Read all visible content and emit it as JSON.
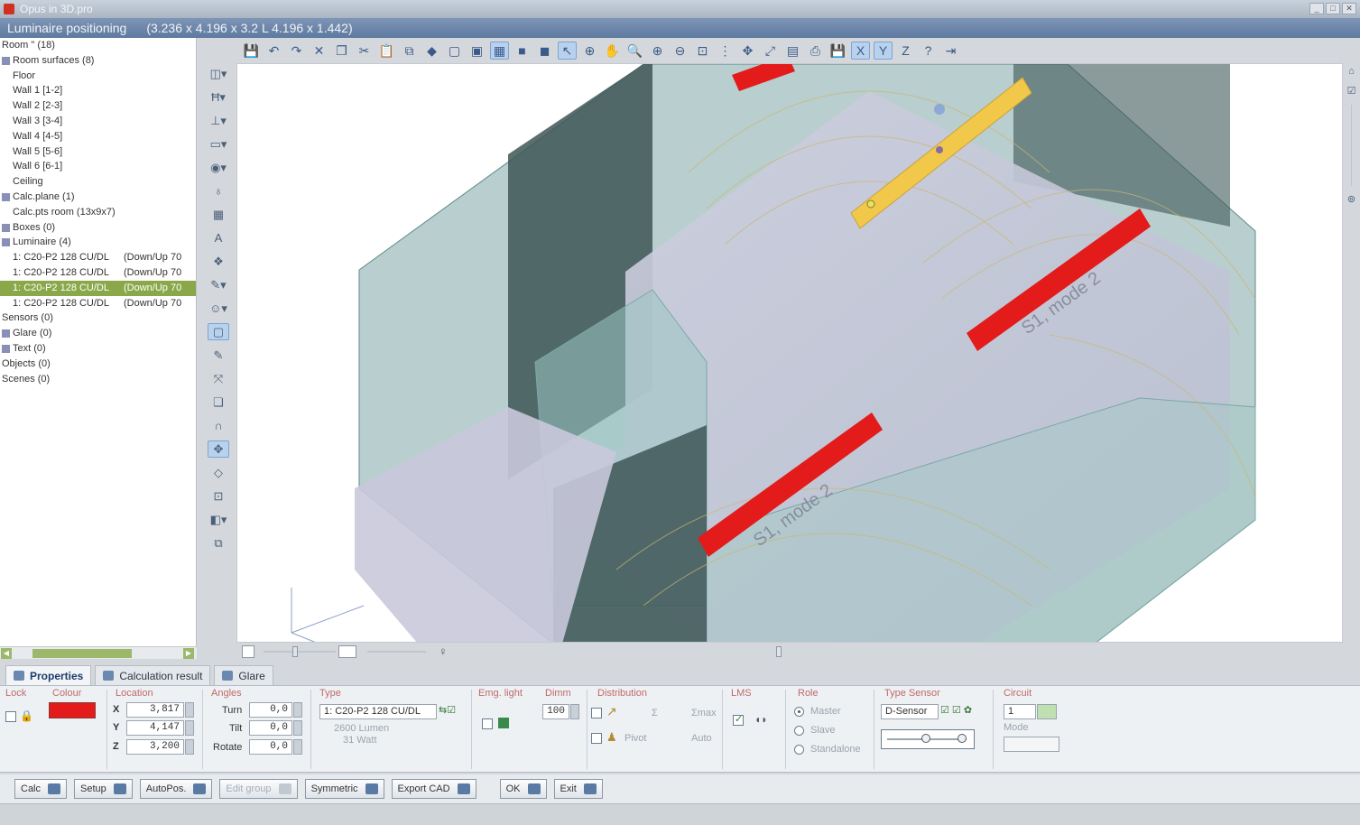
{
  "window": {
    "app_title": "Opus in 3D.pro",
    "subtitle": "Luminaire positioning",
    "dimensions": "(3.236 x 4.196 x 3.2 L 4.196 x 1.442)"
  },
  "tree": [
    {
      "label": "Room \" (18)",
      "indent": 0,
      "icon": false
    },
    {
      "label": "Room surfaces (8)",
      "indent": 0,
      "icon": true
    },
    {
      "label": "Floor",
      "indent": 12
    },
    {
      "label": "Wall 1 [1-2]",
      "indent": 12
    },
    {
      "label": "Wall 2 [2-3]",
      "indent": 12
    },
    {
      "label": "Wall 3 [3-4]",
      "indent": 12
    },
    {
      "label": "Wall 4 [4-5]",
      "indent": 12
    },
    {
      "label": "Wall 5 [5-6]",
      "indent": 12
    },
    {
      "label": "Wall 6 [6-1]",
      "indent": 12
    },
    {
      "label": "Ceiling",
      "indent": 12
    },
    {
      "label": "Calc.plane (1)",
      "indent": 0,
      "icon": true
    },
    {
      "label": "Calc.pts room (13x9x7)",
      "indent": 12
    },
    {
      "label": "Boxes (0)",
      "indent": 0,
      "icon": true
    },
    {
      "label": "Luminaire (4)",
      "indent": 0,
      "icon": true
    },
    {
      "label": "1: C20-P2 128 CU/DL",
      "col2": "(Down/Up 70",
      "indent": 12
    },
    {
      "label": "1: C20-P2 128 CU/DL",
      "col2": "(Down/Up 70",
      "indent": 12
    },
    {
      "label": "1: C20-P2 128 CU/DL",
      "col2": "(Down/Up 70",
      "indent": 12,
      "selected": true
    },
    {
      "label": "1: C20-P2 128 CU/DL",
      "col2": "(Down/Up 70",
      "indent": 12
    },
    {
      "label": "Sensors (0)",
      "indent": 0
    },
    {
      "label": "Glare (0)",
      "indent": 0,
      "icon": true
    },
    {
      "label": "Text (0)",
      "indent": 0,
      "icon": true
    },
    {
      "label": "Objects (0)",
      "indent": 0
    },
    {
      "label": "Scenes (0)",
      "indent": 0
    }
  ],
  "toolbar_top": [
    {
      "icon": "save-icon",
      "glyph": "💾"
    },
    {
      "icon": "undo-icon",
      "glyph": "↶"
    },
    {
      "icon": "redo-icon",
      "glyph": "↷"
    },
    {
      "icon": "delete-icon",
      "glyph": "✕"
    },
    {
      "icon": "copy-icon",
      "glyph": "❐"
    },
    {
      "icon": "cut-icon",
      "glyph": "✂"
    },
    {
      "icon": "paste-icon",
      "glyph": "📋"
    },
    {
      "icon": "duplicate-icon",
      "glyph": "⧉"
    },
    {
      "icon": "render-icon",
      "glyph": "◆"
    },
    {
      "icon": "view-front-icon",
      "glyph": "▢"
    },
    {
      "icon": "view-side-icon",
      "glyph": "▣"
    },
    {
      "icon": "view-top-icon",
      "glyph": "▦",
      "active": true
    },
    {
      "icon": "view-3d-icon",
      "glyph": "■"
    },
    {
      "icon": "view-iso-icon",
      "glyph": "◼"
    },
    {
      "icon": "select-icon",
      "glyph": "↖",
      "active": true
    },
    {
      "icon": "rotate-view-icon",
      "glyph": "⊕"
    },
    {
      "icon": "pan-icon",
      "glyph": "✋"
    },
    {
      "icon": "zoom-icon",
      "glyph": "🔍"
    },
    {
      "icon": "zoom-in-icon",
      "glyph": "⊕"
    },
    {
      "icon": "zoom-out-icon",
      "glyph": "⊖"
    },
    {
      "icon": "zoom-fit-icon",
      "glyph": "⊡"
    },
    {
      "icon": "grid-icon",
      "glyph": "⋮"
    },
    {
      "icon": "move-icon",
      "glyph": "✥"
    },
    {
      "icon": "measure-icon",
      "glyph": "⤢"
    },
    {
      "icon": "display-mode-icon",
      "glyph": "▤"
    },
    {
      "icon": "print-icon",
      "glyph": "⎙"
    },
    {
      "icon": "export-icon",
      "glyph": "💾"
    },
    {
      "icon": "xyz-icon",
      "glyph": "X",
      "active": true
    },
    {
      "icon": "y-axis-icon",
      "glyph": "Y",
      "active": true
    },
    {
      "icon": "z-axis-icon",
      "glyph": "Z"
    },
    {
      "icon": "help-icon",
      "glyph": "?"
    },
    {
      "icon": "exit-icon",
      "glyph": "⇥"
    }
  ],
  "toolbar_left": [
    {
      "icon": "box-tool-icon",
      "glyph": "◫▾"
    },
    {
      "icon": "luminaire-tool-icon",
      "glyph": "Ħ▾"
    },
    {
      "icon": "array-tool-icon",
      "glyph": "⊥▾"
    },
    {
      "icon": "plane-tool-icon",
      "glyph": "▭▾"
    },
    {
      "icon": "sensor-tool-icon",
      "glyph": "◉▾"
    },
    {
      "icon": "glare-tool-icon",
      "glyph": "♁"
    },
    {
      "icon": "calc-grid-icon",
      "glyph": "▦"
    },
    {
      "icon": "text-tool-icon",
      "glyph": "A"
    },
    {
      "icon": "object-tool-icon",
      "glyph": "❖"
    },
    {
      "icon": "light-tool-icon",
      "glyph": "✎▾"
    },
    {
      "icon": "person-tool-icon",
      "glyph": "☺▾"
    },
    {
      "icon": "frame-tool-icon",
      "glyph": "▢",
      "active": true
    },
    {
      "icon": "edit-tool-icon",
      "glyph": "✎"
    },
    {
      "icon": "distribute-tool-icon",
      "glyph": "⤧"
    },
    {
      "icon": "layer-tool-icon",
      "glyph": "❏"
    },
    {
      "icon": "curve-tool-icon",
      "glyph": "∩"
    },
    {
      "icon": "move-tool-icon",
      "glyph": "✥",
      "active": true
    },
    {
      "icon": "surface-tool-icon",
      "glyph": "◇"
    },
    {
      "icon": "section-tool-icon",
      "glyph": "⊡"
    },
    {
      "icon": "view-cube-icon",
      "glyph": "◧▾"
    },
    {
      "icon": "group-tool-icon",
      "glyph": "⧉"
    }
  ],
  "viewport": {
    "luminaire_label_1": "S1, mode 2",
    "luminaire_label_2": "S1, mode 2"
  },
  "tabs": [
    {
      "label": "Properties",
      "active": true
    },
    {
      "label": "Calculation result"
    },
    {
      "label": "Glare"
    }
  ],
  "props": {
    "lock": "Lock",
    "colour": "Colour",
    "colour_value": "#e31b1b",
    "location": "Location",
    "x_label": "X",
    "y_label": "Y",
    "z_label": "Z",
    "x": "3,817",
    "y": "4,147",
    "z": "3,200",
    "angles": "Angles",
    "turn_label": "Turn",
    "tilt_label": "Tilt",
    "rotate_label": "Rotate",
    "turn": "0,0",
    "tilt": "0,0",
    "rotate": "0,0",
    "type": "Type",
    "type_value": "1: C20-P2 128 CU/DL",
    "type_lumen": "2600 Lumen",
    "type_watt": "31 Watt",
    "emg_light": "Emg. light",
    "dimm": "Dimm",
    "dimm_value": "100",
    "distribution": "Distribution",
    "dist_sym": "Σ",
    "dist_max": "Σmax",
    "pivot": "Pivot",
    "auto": "Auto",
    "lms": "LMS",
    "role": "Role",
    "role_master": "Master",
    "role_slave": "Slave",
    "role_standalone": "Standalone",
    "type_sensor": "Type Sensor",
    "sensor_value": "D-Sensor",
    "circuit": "Circuit",
    "circuit_value": "1",
    "mode": "Mode"
  },
  "bottom_buttons": [
    {
      "label": "Calc",
      "name": "calc-button"
    },
    {
      "label": "Setup",
      "name": "setup-button"
    },
    {
      "label": "AutoPos.",
      "name": "autopos-button"
    },
    {
      "label": "Edit group",
      "name": "edit-group-button",
      "disabled": true
    },
    {
      "label": "Symmetric",
      "name": "symmetric-button"
    },
    {
      "label": "Export CAD",
      "name": "export-cad-button"
    },
    {
      "label": "OK",
      "name": "ok-button"
    },
    {
      "label": "Exit",
      "name": "exit-button"
    }
  ]
}
